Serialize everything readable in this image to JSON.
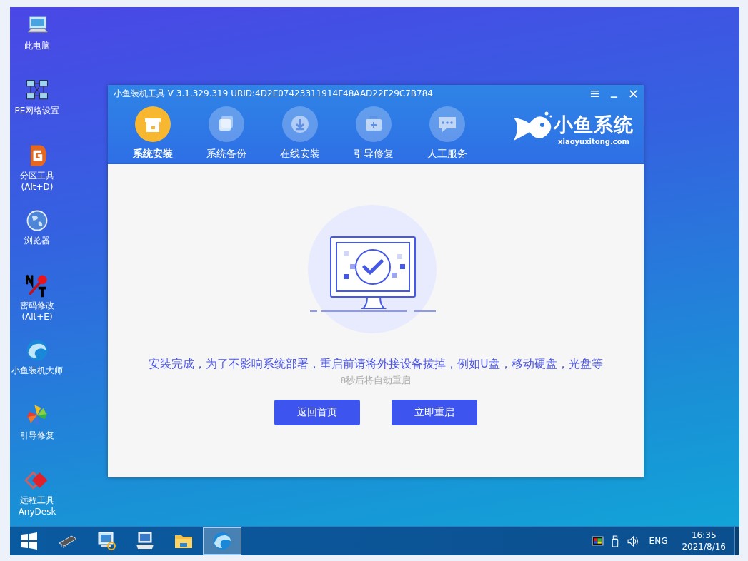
{
  "desktop_icons": [
    {
      "label": "此电脑",
      "kind": "computer"
    },
    {
      "label": "PE网络设置",
      "kind": "network"
    },
    {
      "label": "分区工具\n(Alt+D)",
      "kind": "partition"
    },
    {
      "label": "浏览器",
      "kind": "globe"
    },
    {
      "label": "密码修改\n(Alt+E)",
      "kind": "key"
    },
    {
      "label": "小鱼装机大师",
      "kind": "wave"
    },
    {
      "label": "引导修复",
      "kind": "pinwheel"
    },
    {
      "label": "远程工具\nAnyDesk",
      "kind": "remote"
    }
  ],
  "window": {
    "title": "小鱼装机工具 V 3.1.329.319 URID:4D2E07423311914F48AAD22F29C7B784",
    "tabs": [
      {
        "label": "系统安装",
        "kind": "box",
        "selected": true
      },
      {
        "label": "系统备份",
        "kind": "copies",
        "selected": false
      },
      {
        "label": "在线安装",
        "kind": "download",
        "selected": false
      },
      {
        "label": "引导修复",
        "kind": "toolbox",
        "selected": false
      },
      {
        "label": "人工服务",
        "kind": "chat",
        "selected": false
      }
    ],
    "logo": {
      "name": "小鱼系统",
      "url": "xiaoyuxitong.com"
    },
    "message": "安装完成，为了不影响系统部署，重启前请将外接设备拔掉，例如U盘，移动硬盘，光盘等",
    "countdown": "8秒后将自动重启",
    "buttons": [
      "返回首页",
      "立即重启"
    ]
  },
  "taskbar": {
    "apps": [
      {
        "kind": "start",
        "active": false
      },
      {
        "kind": "chip",
        "active": false
      },
      {
        "kind": "network",
        "active": false
      },
      {
        "kind": "keyboard",
        "active": false
      },
      {
        "kind": "folder",
        "active": false
      },
      {
        "kind": "wave",
        "active": true
      }
    ],
    "language": "ENG",
    "time": "16:35",
    "date": "2021/8/16"
  }
}
